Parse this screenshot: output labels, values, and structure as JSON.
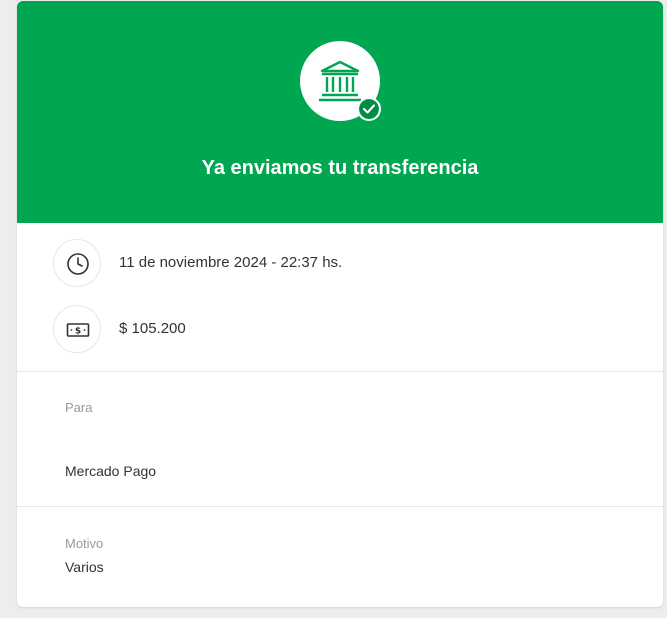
{
  "header": {
    "title": "Ya enviamos tu transferencia",
    "icon": "bank-icon",
    "status_icon": "check-icon",
    "background_color": "#00a650"
  },
  "details": {
    "datetime": {
      "icon": "clock-icon",
      "text": "11 de noviembre 2024 - 22:37 hs."
    },
    "amount": {
      "icon": "money-bill-icon",
      "text": "$ 105.200"
    }
  },
  "recipient": {
    "label": "Para",
    "value": "Mercado Pago"
  },
  "reason": {
    "label": "Motivo",
    "value": "Varios"
  }
}
